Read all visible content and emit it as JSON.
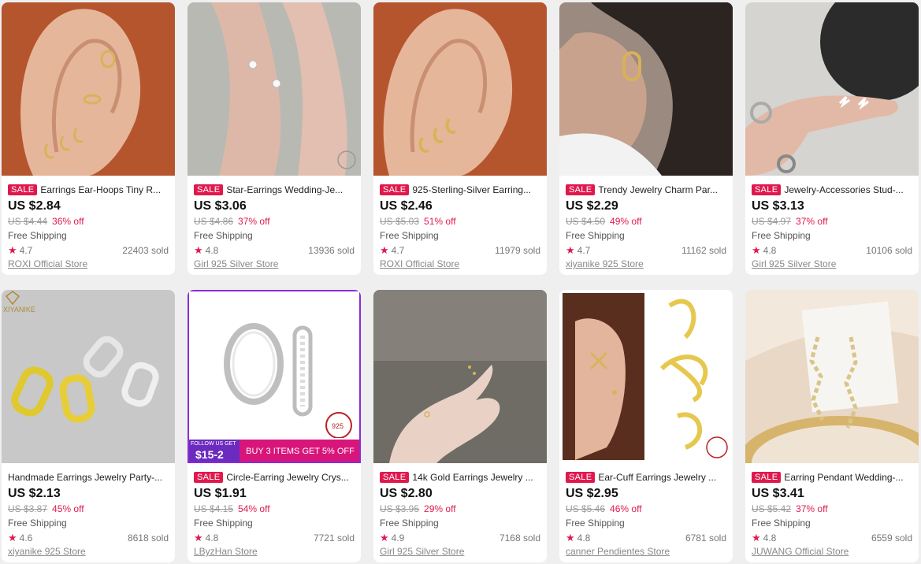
{
  "products": [
    {
      "sale": "SALE",
      "title": "Earrings Ear-Hoops Tiny R...",
      "price": "US $2.84",
      "original": "US $4.44",
      "discount": "36% off",
      "shipping": "Free Shipping",
      "rating": "4.7",
      "sold": "22403 sold",
      "store": "ROXI Official Store"
    },
    {
      "sale": "SALE",
      "title": "Star-Earrings Wedding-Je...",
      "price": "US $3.06",
      "original": "US $4.86",
      "discount": "37% off",
      "shipping": "Free Shipping",
      "rating": "4.8",
      "sold": "13936 sold",
      "store": "Girl 925 Silver Store"
    },
    {
      "sale": "SALE",
      "title": "925-Sterling-Silver Earring...",
      "price": "US $2.46",
      "original": "US $5.03",
      "discount": "51% off",
      "shipping": "Free Shipping",
      "rating": "4.7",
      "sold": "11979 sold",
      "store": "ROXI Official Store"
    },
    {
      "sale": "SALE",
      "title": "Trendy Jewelry Charm Par...",
      "price": "US $2.29",
      "original": "US $4.50",
      "discount": "49% off",
      "shipping": "Free Shipping",
      "rating": "4.7",
      "sold": "11162 sold",
      "store": "xiyanike 925 Store"
    },
    {
      "sale": "SALE",
      "title": "Jewelry-Accessories Stud-...",
      "price": "US $3.13",
      "original": "US $4.97",
      "discount": "37% off",
      "shipping": "Free Shipping",
      "rating": "4.8",
      "sold": "10106 sold",
      "store": "Girl 925 Silver Store"
    },
    {
      "sale": "",
      "title": "Handmade Earrings Jewelry Party-...",
      "price": "US $2.13",
      "original": "US $3.87",
      "discount": "45% off",
      "shipping": "Free Shipping",
      "rating": "4.6",
      "sold": "8618 sold",
      "store": "xiyanike 925 Store"
    },
    {
      "sale": "SALE",
      "title": "Circle-Earring Jewelry Crys...",
      "price": "US $1.91",
      "original": "US $4.15",
      "discount": "54% off",
      "shipping": "Free Shipping",
      "rating": "4.8",
      "sold": "7721 sold",
      "store": "LByzHan Store"
    },
    {
      "sale": "SALE",
      "title": "14k Gold Earrings Jewelry ...",
      "price": "US $2.80",
      "original": "US $3.95",
      "discount": "29% off",
      "shipping": "Free Shipping",
      "rating": "4.9",
      "sold": "7168 sold",
      "store": "Girl 925 Silver Store"
    },
    {
      "sale": "SALE",
      "title": "Ear-Cuff Earrings Jewelry ...",
      "price": "US $2.95",
      "original": "US $5.46",
      "discount": "46% off",
      "shipping": "Free Shipping",
      "rating": "4.8",
      "sold": "6781 sold",
      "store": "canner Pendientes Store"
    },
    {
      "sale": "SALE",
      "title": "Earring Pendant Wedding-...",
      "price": "US $3.41",
      "original": "US $5.42",
      "discount": "37% off",
      "shipping": "Free Shipping",
      "rating": "4.8",
      "sold": "6559 sold",
      "store": "JUWANG Official Store"
    }
  ],
  "images": {
    "brand_text": "XIYANIKE",
    "promo_small": "FOLLOW US GET",
    "promo_big": "$15-2",
    "promo_right": "BUY 3 ITEMS GET 5% OFF",
    "badge": "925"
  },
  "colors": {
    "sale": "#e0194d",
    "background": "#efefef"
  }
}
